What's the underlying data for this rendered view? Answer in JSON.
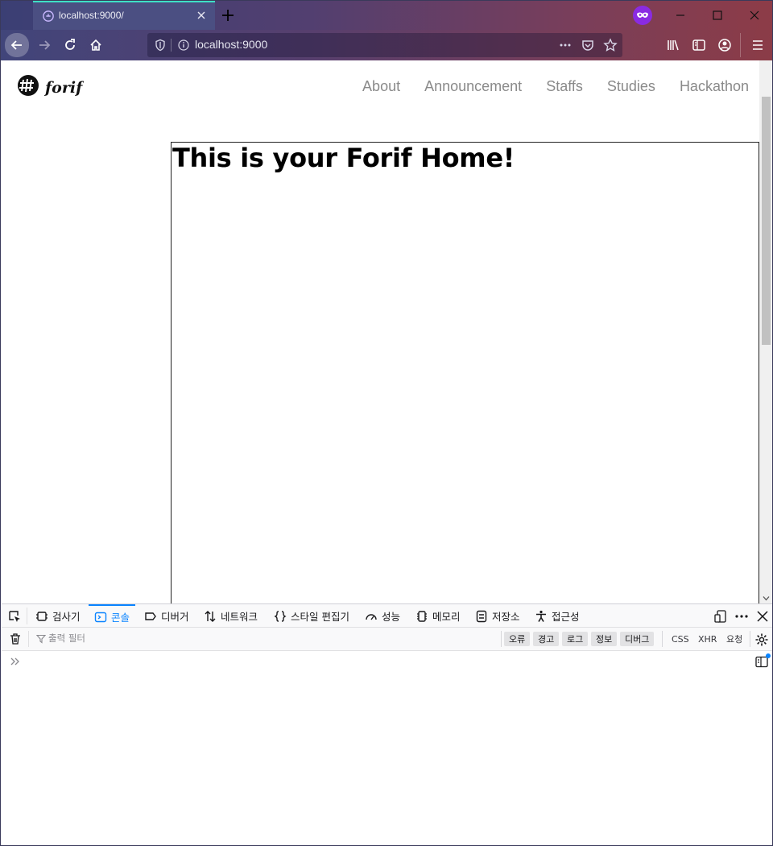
{
  "browser": {
    "tab_title": "localhost:9000/",
    "url": "localhost:9000",
    "accent_color": "#3ee0c5",
    "private_color": "#8a2be2"
  },
  "site": {
    "logo_icon": "forif-logo-icon",
    "nav": [
      {
        "label": "About"
      },
      {
        "label": "Announcement"
      },
      {
        "label": "Staffs"
      },
      {
        "label": "Studies"
      },
      {
        "label": "Hackathon"
      }
    ],
    "heading": "This is your Forif Home!"
  },
  "devtools": {
    "tabs": [
      {
        "label": "검사기",
        "icon": "inspector-icon"
      },
      {
        "label": "콘솔",
        "icon": "console-icon",
        "active": true
      },
      {
        "label": "디버거",
        "icon": "debugger-icon"
      },
      {
        "label": "네트워크",
        "icon": "network-icon"
      },
      {
        "label": "스타일 편집기",
        "icon": "style-editor-icon"
      },
      {
        "label": "성능",
        "icon": "performance-icon"
      },
      {
        "label": "메모리",
        "icon": "memory-icon"
      },
      {
        "label": "저장소",
        "icon": "storage-icon"
      },
      {
        "label": "접근성",
        "icon": "accessibility-icon"
      }
    ],
    "filter_placeholder": "출력 필터",
    "levels": [
      "오류",
      "경고",
      "로그",
      "정보",
      "디버그"
    ],
    "extra_filters": [
      "CSS",
      "XHR",
      "요청"
    ],
    "active_color": "#0a84ff"
  }
}
